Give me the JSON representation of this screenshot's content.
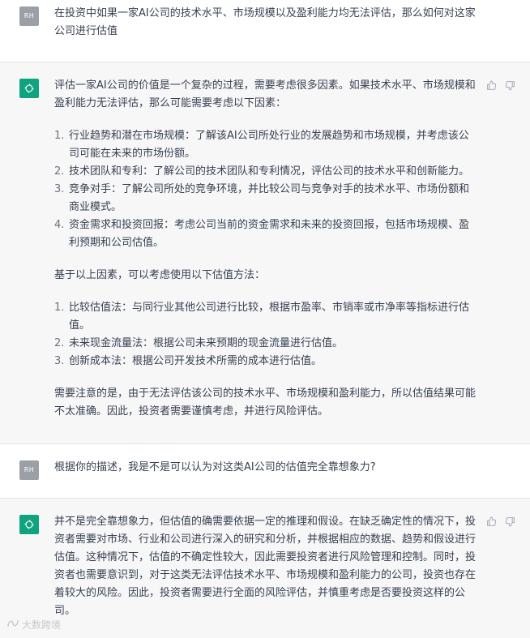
{
  "conversation": {
    "q1": {
      "avatar": "RH",
      "text": "在投资中如果一家AI公司的技术水平、市场规模以及盈利能力均无法评估，那么如何对这家公司进行估值"
    },
    "a1": {
      "intro": "评估一家AI公司的价值是一个复杂的过程，需要考虑很多因素。如果技术水平、市场规模和盈利能力无法评估，那么可能需要考虑以下因素：",
      "factors": [
        {
          "num": "1.",
          "text": "行业趋势和潜在市场规模：了解该AI公司所处行业的发展趋势和市场规模，并考虑该公司可能在未来的市场份额。"
        },
        {
          "num": "2.",
          "text": "技术团队和专利：了解公司的技术团队和专利情况，评估公司的技术水平和创新能力。"
        },
        {
          "num": "3.",
          "text": "竞争对手：了解公司所处的竞争环境，并比较公司与竞争对手的技术水平、市场份额和商业模式。"
        },
        {
          "num": "4.",
          "text": "资金需求和投资回报：考虑公司当前的资金需求和未来的投资回报，包括市场规模、盈利预期和公司估值。"
        }
      ],
      "methods_intro": "基于以上因素，可以考虑使用以下估值方法：",
      "methods": [
        {
          "num": "1.",
          "text": "比较估值法：与同行业其他公司进行比较，根据市盈率、市销率或市净率等指标进行估值。"
        },
        {
          "num": "2.",
          "text": "未来现金流量法：根据公司未来预期的现金流量进行估值。"
        },
        {
          "num": "3.",
          "text": "创新成本法：根据公司开发技术所需的成本进行估值。"
        }
      ],
      "conclusion": "需要注意的是，由于无法评估该公司的技术水平、市场规模和盈利能力，所以估值结果可能不太准确。因此，投资者需要谨慎考虑，并进行风险评估。"
    },
    "q2": {
      "avatar": "RH",
      "text": "根据你的描述，我是不是可以认为对这类AI公司的估值完全靠想象力?"
    },
    "a2": {
      "text": "并不是完全靠想象力，但估值的确需要依据一定的推理和假设。在缺乏确定性的情况下，投资者需要对市场、行业和公司进行深入的研究和分析，并根据相应的数据、趋势和假设进行估值。这种情况下，估值的不确定性较大，因此需要投资者进行风险管理和控制。同时，投资者也需要意识到，对于这类无法评估技术水平、市场规模和盈利能力的公司，投资也存在着较大的风险。因此，投资者需要进行全面的风险评估，并慎重考虑是否要投资这样的公司。"
    }
  },
  "icons": {
    "assistant_avatar": "openai-logo-icon",
    "thumbs_up": "thumbs-up-icon",
    "thumbs_down": "thumbs-down-icon"
  },
  "colors": {
    "assistant_bg": "#f7f7f8",
    "gpt_green": "#10a37f",
    "user_avatar": "#9aa0a6"
  },
  "watermark": "大数跨境"
}
